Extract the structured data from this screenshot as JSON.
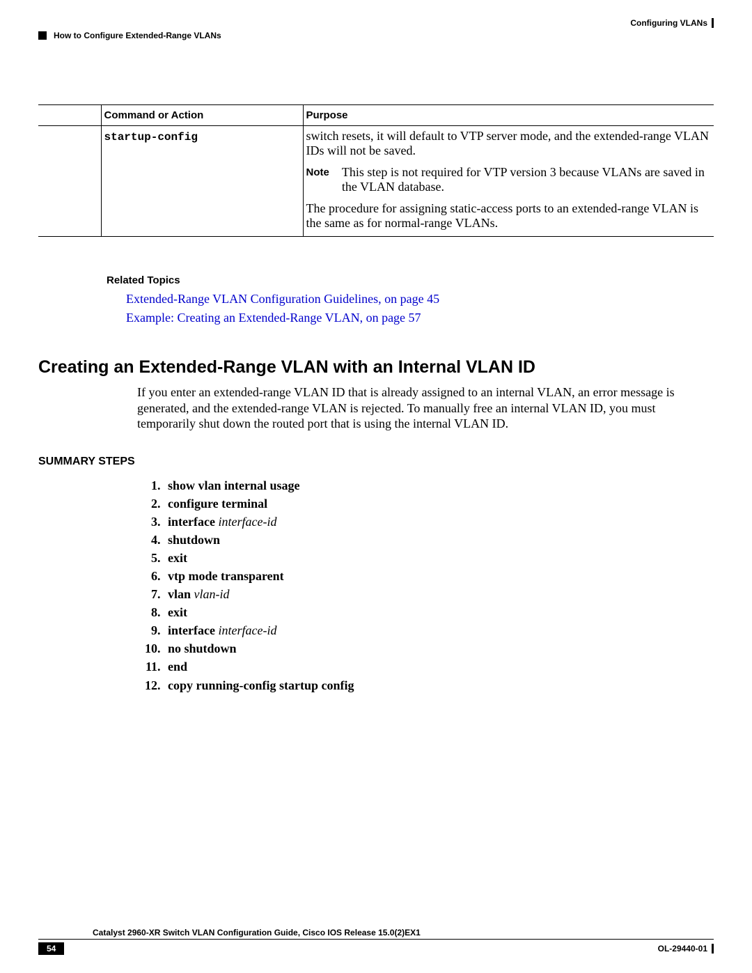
{
  "header": {
    "chapter_title": "Configuring VLANs",
    "section_title": "How to Configure Extended-Range VLANs"
  },
  "table": {
    "headers": {
      "step": "",
      "command": "Command or Action",
      "purpose": "Purpose"
    },
    "row": {
      "command": "startup-config",
      "purpose_para1": "switch resets, it will default to VTP server mode, and the extended-range VLAN IDs will not be saved.",
      "note_label": "Note",
      "note_text": "This step is not required for VTP version 3 because VLANs are saved in the VLAN database.",
      "purpose_para2": "The procedure for assigning static-access ports to an extended-range VLAN is the same as for normal-range VLANs."
    }
  },
  "related": {
    "title": "Related Topics",
    "links": [
      "Extended-Range VLAN Configuration Guidelines,  on page 45",
      "Example: Creating an Extended-Range VLAN,  on page 57"
    ]
  },
  "section": {
    "heading": "Creating an Extended-Range VLAN with an Internal VLAN ID",
    "intro": "If you enter an extended-range VLAN ID that is already assigned to an internal VLAN, an error message is generated, and the extended-range VLAN is rejected. To manually free an internal VLAN ID, you must temporarily shut down the routed port that is using the internal VLAN ID."
  },
  "summary": {
    "title": "SUMMARY STEPS",
    "steps": [
      {
        "bold": "show vlan internal usage",
        "italic": ""
      },
      {
        "bold": "configure terminal",
        "italic": ""
      },
      {
        "bold": "interface ",
        "italic": "interface-id"
      },
      {
        "bold": "shutdown",
        "italic": ""
      },
      {
        "bold": "exit",
        "italic": ""
      },
      {
        "bold": "vtp mode transparent",
        "italic": ""
      },
      {
        "bold": "vlan ",
        "italic": "vlan-id"
      },
      {
        "bold": "exit",
        "italic": ""
      },
      {
        "bold": "interface ",
        "italic": "interface-id"
      },
      {
        "bold": "no shutdown",
        "italic": ""
      },
      {
        "bold": "end",
        "italic": ""
      },
      {
        "bold": "copy running-config startup config",
        "italic": ""
      }
    ]
  },
  "footer": {
    "book_title": "Catalyst 2960-XR Switch VLAN Configuration Guide, Cisco IOS Release 15.0(2)EX1",
    "page_number": "54",
    "doc_id": "OL-29440-01"
  }
}
